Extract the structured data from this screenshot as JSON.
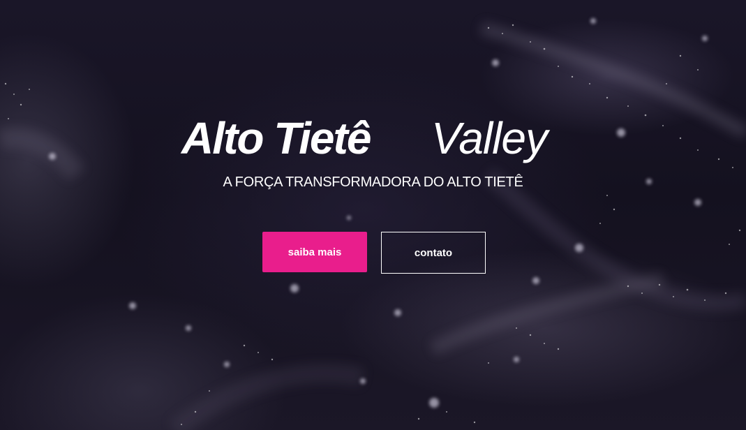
{
  "brand": {
    "title_bold": "Alto Tietê",
    "title_light": "Valley",
    "tagline": "A FORÇA TRANSFORMADORA DO ALTO TIETÊ"
  },
  "actions": {
    "primary_label": "saiba mais",
    "secondary_label": "contato"
  },
  "colors": {
    "accent": "#e91e8c",
    "background": "#14111f",
    "text": "#ffffff"
  }
}
